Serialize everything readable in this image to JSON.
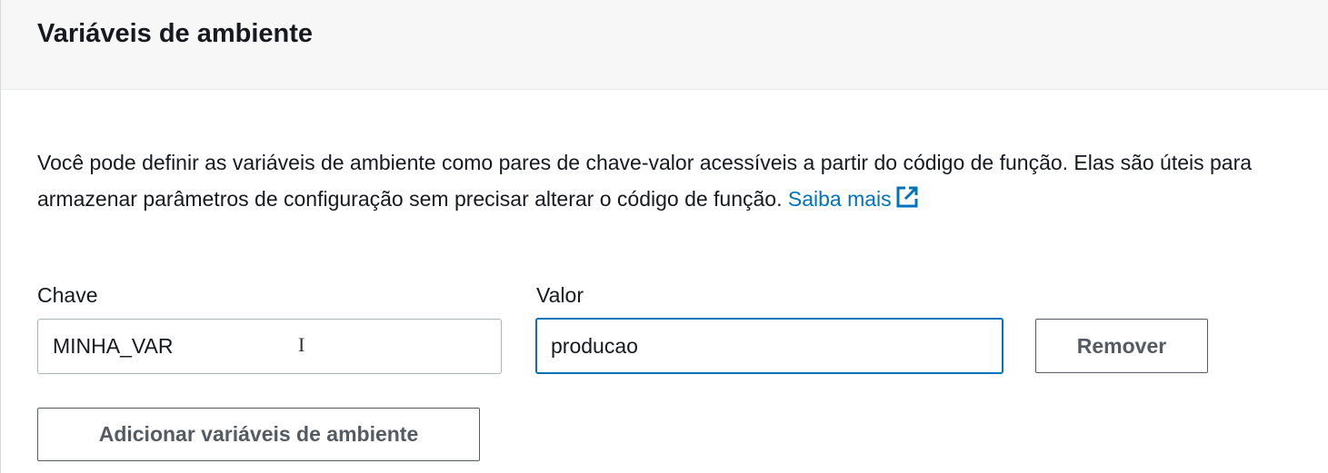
{
  "section": {
    "title": "Variáveis de ambiente",
    "description": "Você pode definir as variáveis de ambiente como pares de chave-valor acessíveis a partir do código de função. Elas são úteis para armazenar parâmetros de configuração sem precisar alterar o código de função.",
    "learn_more": "Saiba mais"
  },
  "variables": {
    "key_label": "Chave",
    "value_label": "Valor",
    "rows": [
      {
        "key": "MINHA_VAR",
        "value": "producao"
      }
    ],
    "remove_label": "Remover",
    "add_label": "Adicionar variáveis de ambiente"
  },
  "icons": {
    "learn_more": "external-link-icon",
    "cursor": "text-cursor-icon"
  },
  "colors": {
    "link": "#0073bb",
    "focus_border": "#0073bb",
    "header_background": "#f7f7f7",
    "button_text": "#545b64"
  }
}
